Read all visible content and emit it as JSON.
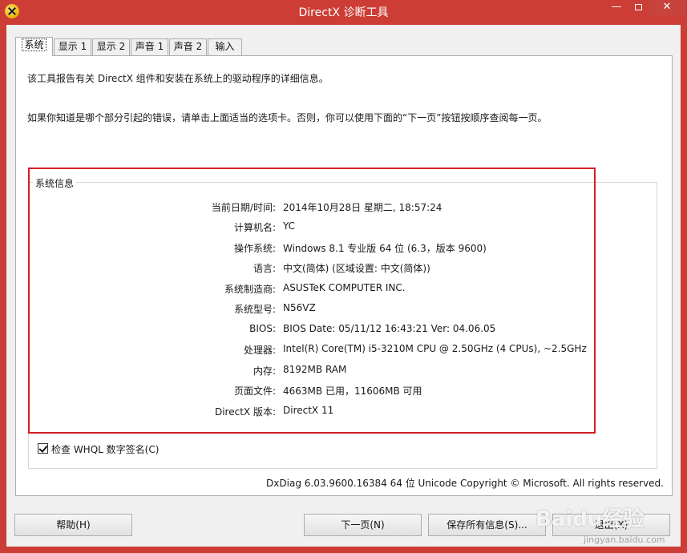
{
  "window": {
    "title": "DirectX 诊断工具",
    "min_glyph": "—",
    "close_glyph": "✕"
  },
  "tabs": [
    {
      "label": "系统",
      "active": true
    },
    {
      "label": "显示 1"
    },
    {
      "label": "显示 2"
    },
    {
      "label": "声音 1"
    },
    {
      "label": "声音 2"
    },
    {
      "label": "输入"
    }
  ],
  "intro": {
    "line1": "该工具报告有关 DirectX 组件和安装在系统上的驱动程序的详细信息。",
    "line2": "如果你知道是哪个部分引起的错误，请单击上面适当的选项卡。否则，你可以使用下面的“下一页”按钮按顺序查阅每一页。"
  },
  "system_info": {
    "group_label": "系统信息",
    "rows": [
      {
        "label": "当前日期/时间:",
        "value": "2014年10月28日 星期二, 18:57:24"
      },
      {
        "label": "计算机名:",
        "value": "YC"
      },
      {
        "label": "操作系统:",
        "value": "Windows 8.1 专业版 64 位 (6.3，版本 9600)"
      },
      {
        "label": "语言:",
        "value": "中文(简体) (区域设置: 中文(简体))"
      },
      {
        "label": "系统制造商:",
        "value": "ASUSTeK COMPUTER INC."
      },
      {
        "label": "系统型号:",
        "value": "N56VZ"
      },
      {
        "label": "BIOS:",
        "value": "BIOS Date: 05/11/12 16:43:21 Ver: 04.06.05"
      },
      {
        "label": "处理器:",
        "value": "Intel(R) Core(TM) i5-3210M CPU @ 2.50GHz (4 CPUs), ~2.5GHz"
      },
      {
        "label": "内存:",
        "value": "8192MB RAM"
      },
      {
        "label": "页面文件:",
        "value": "4663MB 已用，11606MB 可用"
      },
      {
        "label": "DirectX 版本:",
        "value": "DirectX 11"
      }
    ]
  },
  "whql": {
    "label": "检查 WHQL 数字签名(C)",
    "checked": true
  },
  "footer": {
    "version_text": "DxDiag 6.03.9600.16384 64 位 Unicode  Copyright © Microsoft. All rights reserved."
  },
  "buttons": {
    "help": "帮助(H)",
    "next": "下一页(N)",
    "save": "保存所有信息(S)...",
    "exit": "退出(X)"
  },
  "watermark": {
    "main": "Baidu经验",
    "sub": "jingyan.baidu.com"
  },
  "colors": {
    "titlebar": "#cc3d35",
    "highlight_box": "#d41d24"
  }
}
